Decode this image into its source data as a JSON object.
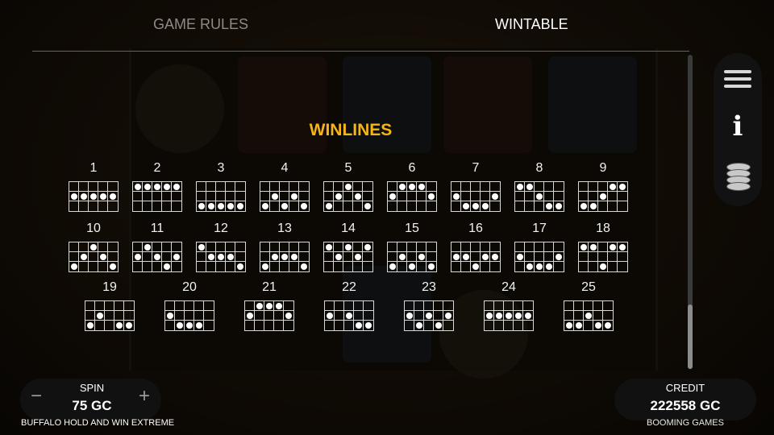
{
  "tabs": {
    "rules": "GAME RULES",
    "wintable": "WINTABLE"
  },
  "section_title": "WINLINES",
  "winlines": [
    {
      "n": "1",
      "rows": [
        "00000",
        "11111",
        "00000"
      ]
    },
    {
      "n": "2",
      "rows": [
        "11111",
        "00000",
        "00000"
      ]
    },
    {
      "n": "3",
      "rows": [
        "00000",
        "00000",
        "11111"
      ]
    },
    {
      "n": "4",
      "rows": [
        "00000",
        "01010",
        "10101"
      ]
    },
    {
      "n": "5",
      "rows": [
        "00100",
        "01010",
        "10001"
      ]
    },
    {
      "n": "6",
      "rows": [
        "01110",
        "10001",
        "00000"
      ]
    },
    {
      "n": "7",
      "rows": [
        "00000",
        "10001",
        "01110"
      ]
    },
    {
      "n": "8",
      "rows": [
        "11000",
        "00100",
        "00011"
      ]
    },
    {
      "n": "9",
      "rows": [
        "00011",
        "00100",
        "11000"
      ]
    },
    {
      "n": "10",
      "rows": [
        "00100",
        "01010",
        "10001"
      ]
    },
    {
      "n": "11",
      "rows": [
        "01000",
        "10101",
        "00010"
      ]
    },
    {
      "n": "12",
      "rows": [
        "10000",
        "01110",
        "00001"
      ]
    },
    {
      "n": "13",
      "rows": [
        "00000",
        "01110",
        "10001"
      ]
    },
    {
      "n": "14",
      "rows": [
        "10101",
        "01010",
        "00000"
      ]
    },
    {
      "n": "15",
      "rows": [
        "00000",
        "01010",
        "10101"
      ]
    },
    {
      "n": "16",
      "rows": [
        "00000",
        "11011",
        "00100"
      ]
    },
    {
      "n": "17",
      "rows": [
        "00000",
        "10001",
        "01110"
      ]
    },
    {
      "n": "18",
      "rows": [
        "11011",
        "00000",
        "00100"
      ]
    },
    {
      "n": "19",
      "rows": [
        "00000",
        "01000",
        "10011"
      ]
    },
    {
      "n": "20",
      "rows": [
        "00000",
        "10000",
        "01110"
      ]
    },
    {
      "n": "21",
      "rows": [
        "01110",
        "10001",
        "00000"
      ]
    },
    {
      "n": "22",
      "rows": [
        "00000",
        "10100",
        "00011"
      ]
    },
    {
      "n": "23",
      "rows": [
        "00000",
        "10101",
        "01010"
      ]
    },
    {
      "n": "24",
      "rows": [
        "00000",
        "11111",
        "00000"
      ]
    },
    {
      "n": "25",
      "rows": [
        "00000",
        "00100",
        "11011"
      ]
    }
  ],
  "bottom": {
    "spin_label": "SPIN",
    "spin_value": "75 GC",
    "minus": "−",
    "plus": "+",
    "game_name": "BUFFALO HOLD AND WIN EXTREME",
    "credit_label": "CREDIT",
    "credit_value": "222558 GC",
    "brand": "BOOMING GAMES"
  },
  "menu": {
    "icons": [
      "menu-icon",
      "info-icon",
      "coins-icon"
    ]
  },
  "colors": {
    "accent": "#f5b417",
    "panel": "#111111"
  }
}
